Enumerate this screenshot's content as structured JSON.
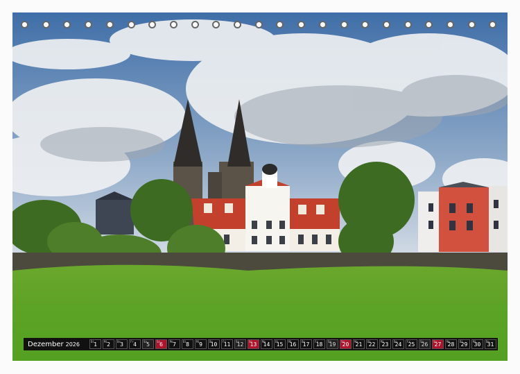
{
  "calendar": {
    "month": "Dezember",
    "year": "2026",
    "days": [
      {
        "d": "1",
        "wd": "Di"
      },
      {
        "d": "2",
        "wd": "Mi"
      },
      {
        "d": "3",
        "wd": "Do"
      },
      {
        "d": "4",
        "wd": "Fr"
      },
      {
        "d": "5",
        "wd": "Sa"
      },
      {
        "d": "6",
        "wd": "So"
      },
      {
        "d": "7",
        "wd": "Mo"
      },
      {
        "d": "8",
        "wd": "Di"
      },
      {
        "d": "9",
        "wd": "Mi"
      },
      {
        "d": "10",
        "wd": "Do"
      },
      {
        "d": "11",
        "wd": "Fr"
      },
      {
        "d": "12",
        "wd": "Sa"
      },
      {
        "d": "13",
        "wd": "So"
      },
      {
        "d": "14",
        "wd": "Mo"
      },
      {
        "d": "15",
        "wd": "Di"
      },
      {
        "d": "16",
        "wd": "Mi"
      },
      {
        "d": "17",
        "wd": "Do"
      },
      {
        "d": "18",
        "wd": "Fr"
      },
      {
        "d": "19",
        "wd": "Sa"
      },
      {
        "d": "20",
        "wd": "So"
      },
      {
        "d": "21",
        "wd": "Mo"
      },
      {
        "d": "22",
        "wd": "Di"
      },
      {
        "d": "23",
        "wd": "Mi"
      },
      {
        "d": "24",
        "wd": "Do"
      },
      {
        "d": "25",
        "wd": "Fr"
      },
      {
        "d": "26",
        "wd": "Sa"
      },
      {
        "d": "27",
        "wd": "So"
      },
      {
        "d": "28",
        "wd": "Mo"
      },
      {
        "d": "29",
        "wd": "Di"
      },
      {
        "d": "30",
        "wd": "Mi"
      },
      {
        "d": "31",
        "wd": "Do"
      }
    ],
    "holiday_color": "#b0122a"
  },
  "binding": {
    "ring_count": 23
  },
  "photo": {
    "subject": "church-with-two-spires-and-white-manor-house"
  }
}
